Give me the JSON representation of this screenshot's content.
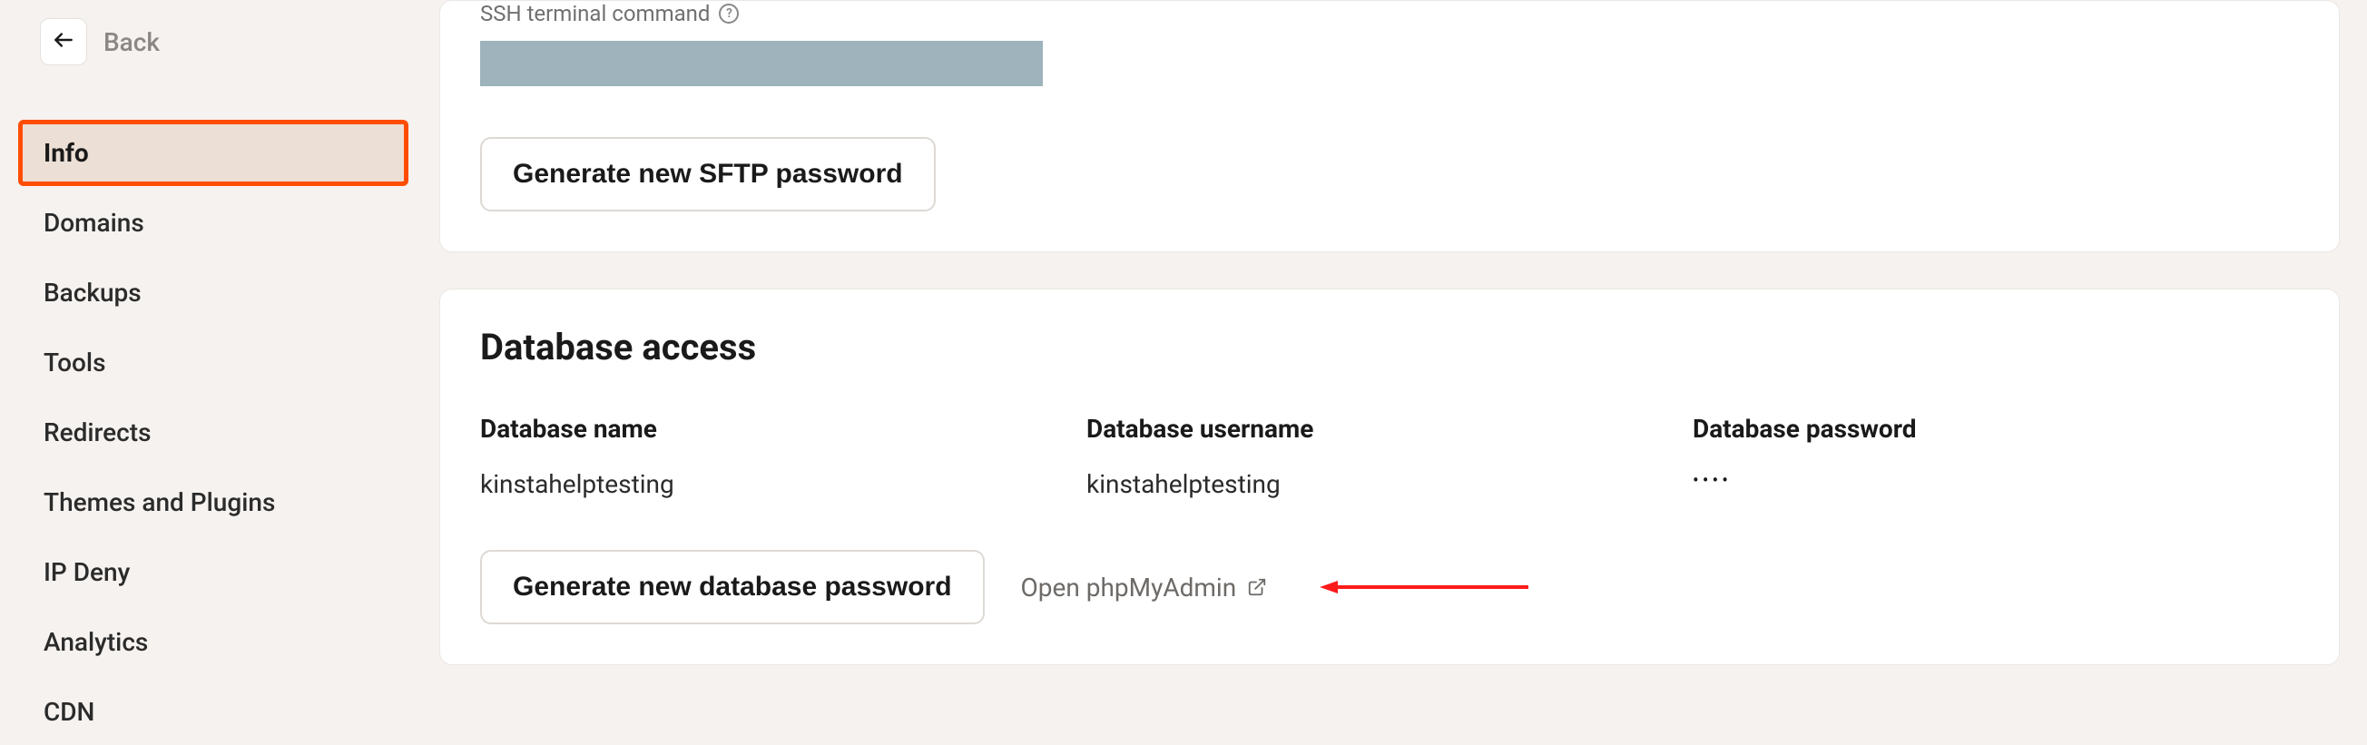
{
  "sidebar": {
    "back_label": "Back",
    "items": [
      {
        "label": "Info",
        "active": true
      },
      {
        "label": "Domains",
        "active": false
      },
      {
        "label": "Backups",
        "active": false
      },
      {
        "label": "Tools",
        "active": false
      },
      {
        "label": "Redirects",
        "active": false
      },
      {
        "label": "Themes and Plugins",
        "active": false
      },
      {
        "label": "IP Deny",
        "active": false
      },
      {
        "label": "Analytics",
        "active": false
      },
      {
        "label": "CDN",
        "active": false
      }
    ]
  },
  "ssh_section": {
    "label": "SSH terminal command",
    "generate_sftp_button": "Generate new SFTP password"
  },
  "db_section": {
    "title": "Database access",
    "name_label": "Database name",
    "name_value": "kinstahelptesting",
    "username_label": "Database username",
    "username_value": "kinstahelptesting",
    "password_label": "Database password",
    "password_value": "••••",
    "generate_db_button": "Generate new database password",
    "open_phpmyadmin": "Open phpMyAdmin"
  }
}
